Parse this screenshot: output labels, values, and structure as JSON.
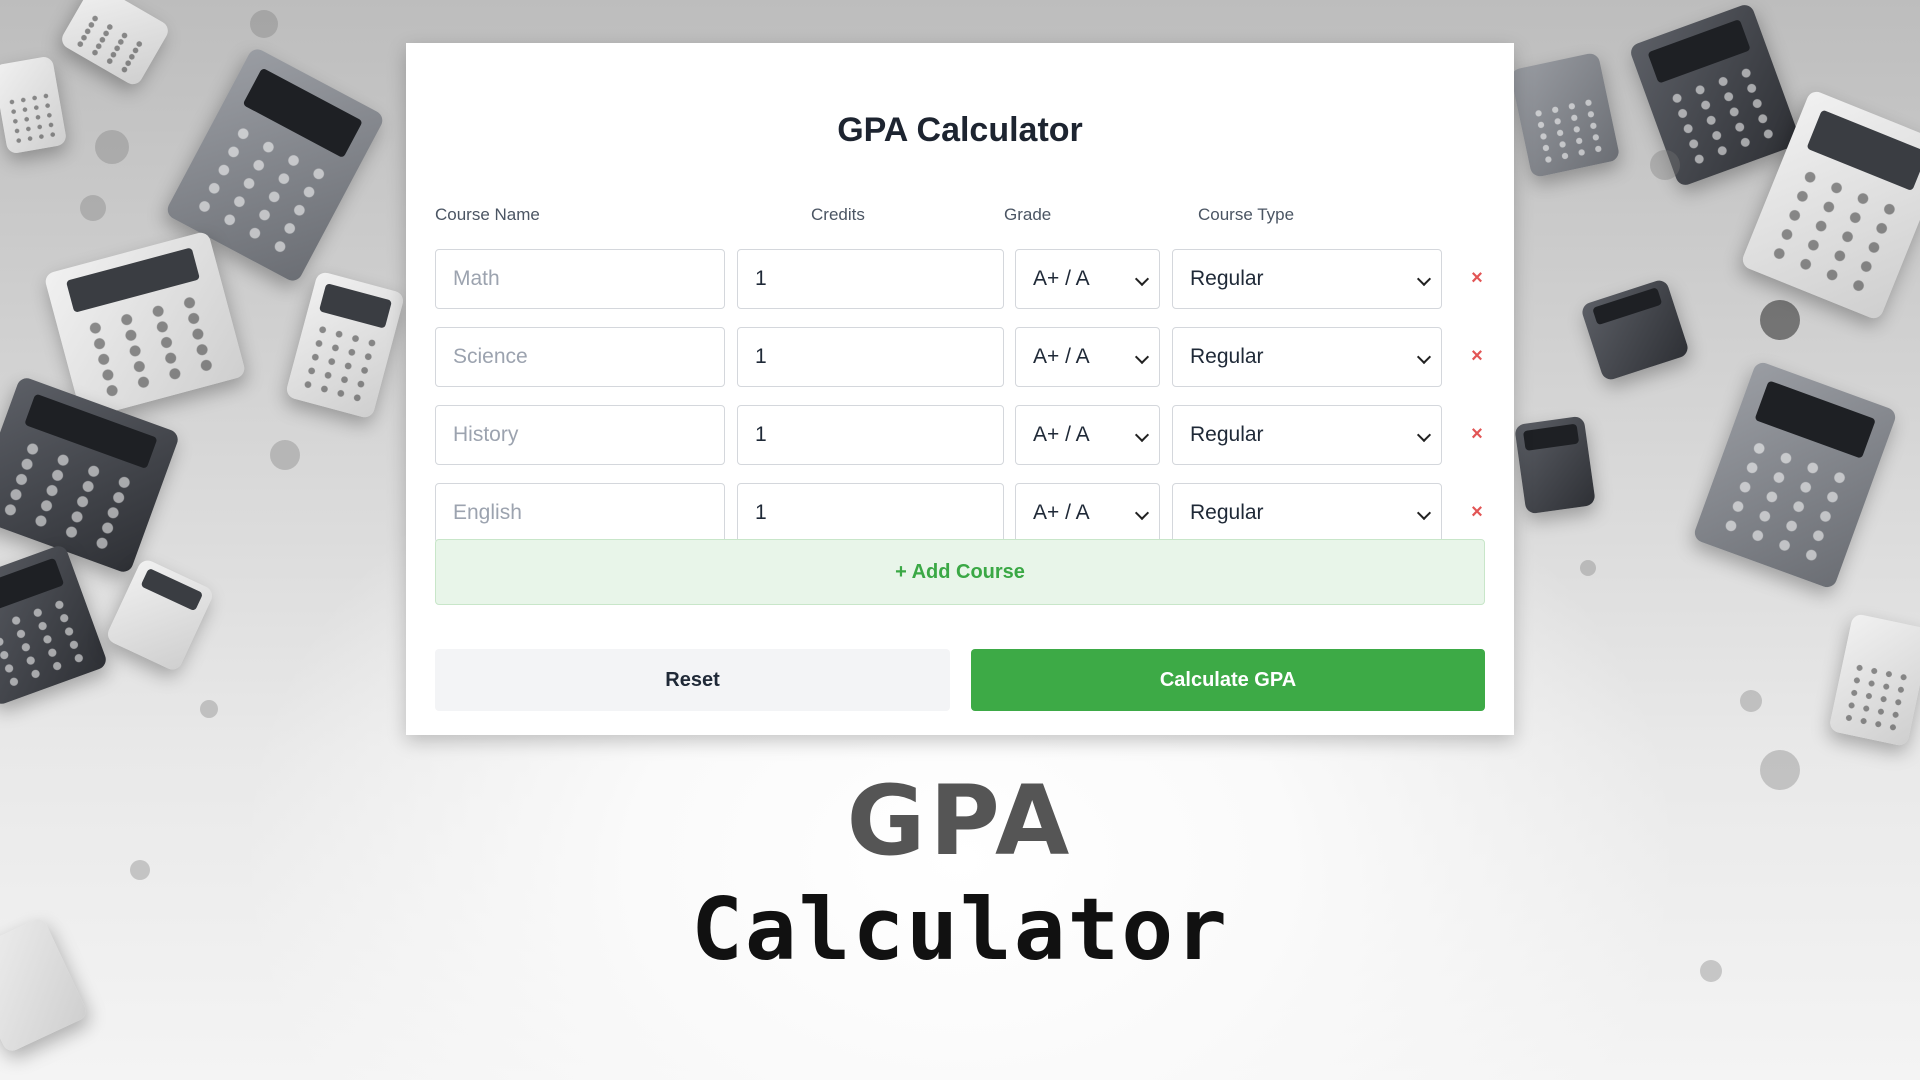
{
  "card": {
    "title": "GPA Calculator",
    "columns": {
      "course_name": "Course Name",
      "credits": "Credits",
      "grade": "Grade",
      "course_type": "Course Type"
    },
    "courses": [
      {
        "name_placeholder": "Math",
        "credits": "1",
        "grade": "A+ / A",
        "type": "Regular"
      },
      {
        "name_placeholder": "Science",
        "credits": "1",
        "grade": "A+ / A",
        "type": "Regular"
      },
      {
        "name_placeholder": "History",
        "credits": "1",
        "grade": "A+ / A",
        "type": "Regular"
      },
      {
        "name_placeholder": "English",
        "credits": "1",
        "grade": "A+ / A",
        "type": "Regular"
      }
    ],
    "remove_symbol": "×",
    "add_course_label": "+ Add Course",
    "reset_label": "Reset",
    "calculate_label": "Calculate GPA"
  },
  "promo": {
    "line1": "GPA",
    "line2": "Calculator"
  },
  "colors": {
    "accent_green": "#3daa46",
    "add_bg": "#e8f5e9",
    "remove_red": "#e25555"
  },
  "icons": {
    "select_arrow": "chevron-down-icon",
    "remove": "close-icon"
  }
}
